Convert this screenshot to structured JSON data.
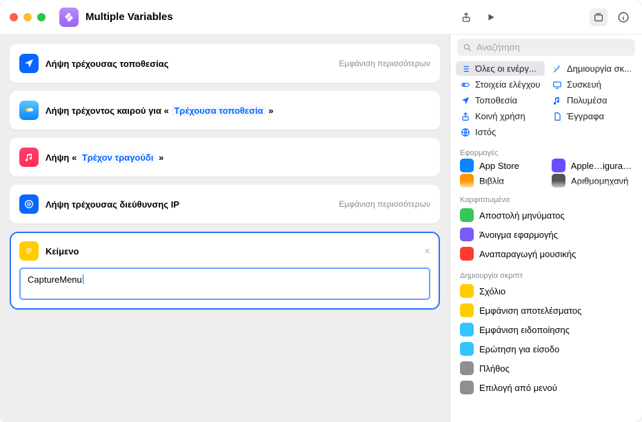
{
  "title": "Multiple Variables",
  "search_placeholder": "Αναζήτηση",
  "more_label": "Εμφάνιση περισσότερων",
  "editor": {
    "location": {
      "label": "Λήψη τρέχουσας τοποθεσίας"
    },
    "weather": {
      "prefix": "Λήψη τρέχοντος καιρού για « ",
      "token": "Τρέχουσα τοποθεσία",
      "suffix": " »"
    },
    "music": {
      "prefix": "Λήψη « ",
      "token": "Τρέχον τραγούδι",
      "suffix": " »"
    },
    "ip": {
      "label": "Λήψη τρέχουσας διεύθυνσης IP"
    },
    "text_card": {
      "title": "Κείμενο",
      "value": "CaptureMenu"
    }
  },
  "categories": [
    {
      "label": "Όλες οι ενέργ...",
      "selected": true,
      "icon": "list",
      "color": "#0a66ff"
    },
    {
      "label": "Δημιουργία σκ...",
      "icon": "wand",
      "color": "#0a66ff"
    },
    {
      "label": "Στοιχεία ελέγχου",
      "icon": "toggle",
      "color": "#0a66ff"
    },
    {
      "label": "Συσκευή",
      "icon": "display",
      "color": "#0a66ff"
    },
    {
      "label": "Τοποθεσία",
      "icon": "nav",
      "color": "#0a66ff"
    },
    {
      "label": "Πολυμέσα",
      "icon": "note",
      "color": "#0a66ff"
    },
    {
      "label": "Κοινή χρήση",
      "icon": "share",
      "color": "#0a66ff"
    },
    {
      "label": "Έγγραφα",
      "icon": "doc",
      "color": "#0a66ff"
    },
    {
      "label": "Ιστός",
      "icon": "globe",
      "color": "#0a66ff"
    }
  ],
  "section_apps": "Εφαρμογές",
  "apps": [
    {
      "label": "App Store",
      "color": "#0a84ff"
    },
    {
      "label": "Apple…igurator",
      "color": "#6b4aff"
    },
    {
      "label": "Βιβλία",
      "color": "#ff9500"
    },
    {
      "label": "Αριθμομηχανή",
      "color": "#555555"
    }
  ],
  "section_pinned": "Καρφιτσωμένα",
  "pinned": [
    {
      "label": "Αποστολή μηνύματος",
      "color": "#34c759"
    },
    {
      "label": "Άνοιγμα εφαρμογής",
      "color": "#7a5af8"
    },
    {
      "label": "Αναπαραγωγή μουσικής",
      "color": "#ff3b30"
    }
  ],
  "section_script": "Δημιουργία σκριπτ",
  "script_actions": [
    {
      "label": "Σχόλιο",
      "color": "#ffcc00"
    },
    {
      "label": "Εμφάνιση αποτελέσματος",
      "color": "#ffcc00"
    },
    {
      "label": "Εμφάνιση ειδοποίησης",
      "color": "#32c5ff"
    },
    {
      "label": "Ερώτηση για είσοδο",
      "color": "#32c5ff"
    },
    {
      "label": "Πλήθος",
      "color": "#8e8e93"
    },
    {
      "label": "Επιλογή από μενού",
      "color": "#8e8e93"
    }
  ]
}
